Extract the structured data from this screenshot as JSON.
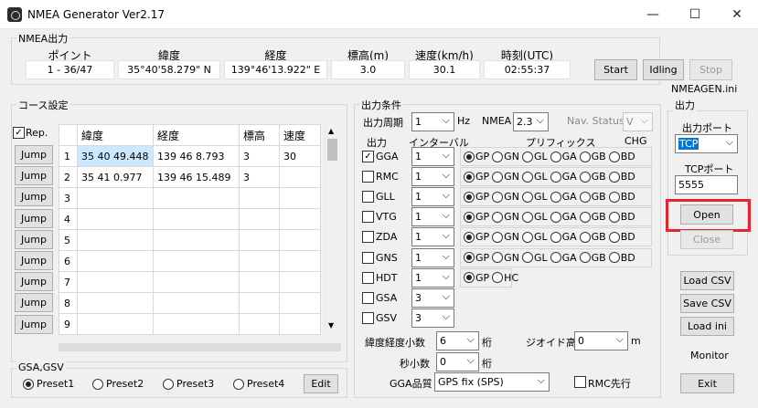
{
  "window": {
    "title": "NMEA Generator Ver2.17",
    "min": "—",
    "max": "☐",
    "close": "✕"
  },
  "nmea_output": {
    "group_label": "NMEA出力",
    "headers": [
      "ポイント",
      "緯度",
      "経度",
      "標高(m)",
      "速度(km/h)",
      "時刻(UTC)"
    ],
    "values": [
      "1 - 36/47",
      "35°40'58.279\" N",
      "139°46'13.922\" E",
      "3.0",
      "30.1",
      "02:55:37"
    ]
  },
  "controls": {
    "start": "Start",
    "idling": "Idling",
    "stop": "Stop",
    "ini_file": "NMEAGEN.ini"
  },
  "course": {
    "group_label": "コース設定",
    "rep_label": "Rep.",
    "rep_checked": true,
    "columns": [
      "緯度",
      "経度",
      "標高",
      "速度"
    ],
    "rows": [
      [
        "1",
        "35 40 49.448",
        "139 46 8.793",
        "3",
        "30"
      ],
      [
        "2",
        "35 41 0.977",
        "139 46 15.489",
        "3",
        ""
      ],
      [
        "3",
        "",
        "",
        "",
        ""
      ],
      [
        "4",
        "",
        "",
        "",
        ""
      ],
      [
        "5",
        "",
        "",
        "",
        ""
      ],
      [
        "6",
        "",
        "",
        "",
        ""
      ],
      [
        "7",
        "",
        "",
        "",
        ""
      ],
      [
        "8",
        "",
        "",
        "",
        ""
      ],
      [
        "9",
        "",
        "",
        "",
        ""
      ]
    ],
    "jump": "Jump"
  },
  "gsa_gsv": {
    "group_label": "GSA,GSV",
    "presets": [
      "Preset1",
      "Preset2",
      "Preset3",
      "Preset4"
    ],
    "selected": "Preset1",
    "edit": "Edit"
  },
  "output_cond": {
    "group_label": "出力条件",
    "period_label": "出力周期",
    "period_value": "1",
    "hz": "Hz",
    "nmea_label": "NMEA",
    "nmea_value": "2.3",
    "navstatus_label": "Nav. Status",
    "navstatus_value": "V",
    "col_output": "出力",
    "col_interval": "インターバル",
    "col_prefix": "プリフィックス",
    "col_chg": "CHG",
    "sentences": [
      {
        "name": "GGA",
        "checked": true,
        "interval": "1",
        "prefix": [
          "GP",
          "GN",
          "GL",
          "GA",
          "GB",
          "BD"
        ],
        "sel": 0
      },
      {
        "name": "RMC",
        "checked": false,
        "interval": "1",
        "prefix": [
          "GP",
          "GN",
          "GL",
          "GA",
          "GB",
          "BD"
        ],
        "sel": 0
      },
      {
        "name": "GLL",
        "checked": false,
        "interval": "1",
        "prefix": [
          "GP",
          "GN",
          "GL",
          "GA",
          "GB",
          "BD"
        ],
        "sel": 0
      },
      {
        "name": "VTG",
        "checked": false,
        "interval": "1",
        "prefix": [
          "GP",
          "GN",
          "GL",
          "GA",
          "GB",
          "BD"
        ],
        "sel": 0
      },
      {
        "name": "ZDA",
        "checked": false,
        "interval": "1",
        "prefix": [
          "GP",
          "GN",
          "GL",
          "GA",
          "GB",
          "BD"
        ],
        "sel": 0
      },
      {
        "name": "GNS",
        "checked": false,
        "interval": "1",
        "prefix": [
          "GP",
          "GN",
          "GL",
          "GA",
          "GB",
          "BD"
        ],
        "sel": 0
      },
      {
        "name": "HDT",
        "checked": false,
        "interval": "1",
        "prefix": [
          "GP",
          "HC"
        ],
        "sel": 0
      },
      {
        "name": "GSA",
        "checked": false,
        "interval": "3",
        "prefix": [],
        "sel": -1
      },
      {
        "name": "GSV",
        "checked": false,
        "interval": "3",
        "prefix": [],
        "sel": -1
      }
    ],
    "latlon_dec_label": "緯度経度小数",
    "latlon_dec_value": "6",
    "keta": "桁",
    "sec_dec_label": "秒小数",
    "sec_dec_value": "0",
    "geoid_label": "ジオイド高",
    "geoid_value": "0",
    "m": "m",
    "gga_quality_label": "GGA品質",
    "gga_quality_value": "GPS fix (SPS)",
    "rmc_first": "RMC先行"
  },
  "output": {
    "group_label": "出力",
    "port_label": "出力ポート",
    "port_value": "TCP",
    "tcp_label": "TCPポート",
    "tcp_value": "5555",
    "open": "Open",
    "close": "Close"
  },
  "side": {
    "load_csv": "Load CSV",
    "save_csv": "Save CSV",
    "load_ini": "Load ini",
    "monitor": "Monitor",
    "exit": "Exit"
  },
  "colors": {
    "highlight": "#e3252d",
    "selection": "#cce8ff",
    "port_select": "#0078d7"
  }
}
